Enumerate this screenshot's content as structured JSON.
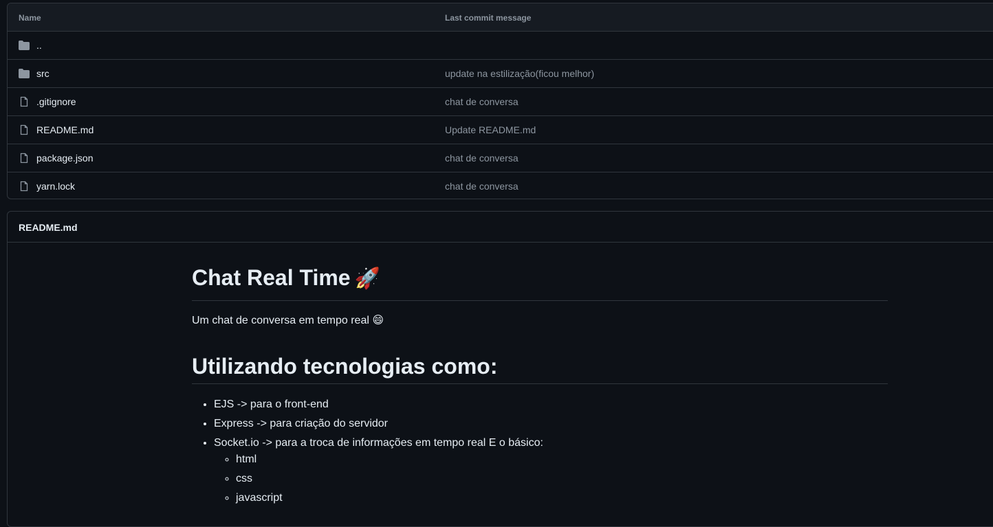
{
  "files": {
    "headers": {
      "name": "Name",
      "message": "Last commit message"
    },
    "rows": [
      {
        "type": "folder",
        "name": "..",
        "message": ""
      },
      {
        "type": "folder",
        "name": "src",
        "message": "update na estilização(ficou melhor)"
      },
      {
        "type": "file",
        "name": ".gitignore",
        "message": "chat de conversa"
      },
      {
        "type": "file",
        "name": "README.md",
        "message": "Update README.md"
      },
      {
        "type": "file",
        "name": "package.json",
        "message": "chat de conversa"
      },
      {
        "type": "file",
        "name": "yarn.lock",
        "message": "chat de conversa"
      }
    ]
  },
  "readme": {
    "title": "README.md",
    "h1": "Chat Real Time",
    "h1_emoji": "🚀",
    "description": "Um chat de conversa em tempo real",
    "description_emoji": "😄",
    "h2": "Utilizando tecnologias como:",
    "items": [
      "EJS -> para o front-end",
      "Express -> para criação do servidor",
      "Socket.io -> para a troca de informações em tempo real E o básico:"
    ],
    "subitems": [
      "html",
      "css",
      "javascript"
    ]
  },
  "colors": {
    "background": "#0d1117",
    "border": "#30363d",
    "muted": "#8d96a0",
    "text": "#e6edf3",
    "folder_icon": "#8d96a0"
  }
}
